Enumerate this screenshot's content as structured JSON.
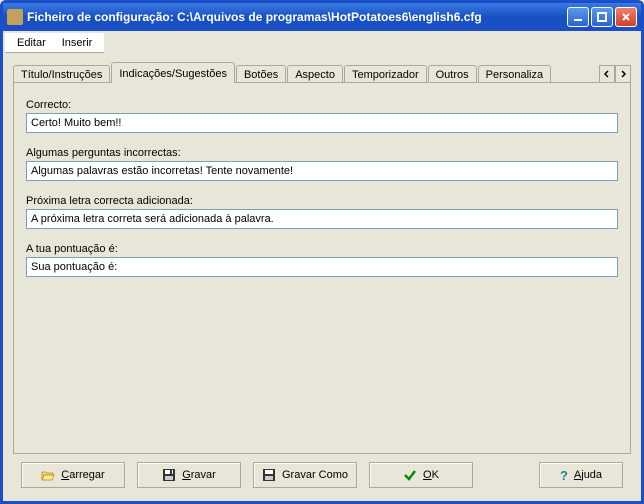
{
  "window": {
    "title": "Ficheiro de configuração: C:\\Arquivos de programas\\HotPotatoes6\\english6.cfg"
  },
  "menu": {
    "edit": "Editar",
    "insert": "Inserir"
  },
  "tabs": {
    "t0": "Título/Instruções",
    "t1": "Indicações/Sugestões",
    "t2": "Botões",
    "t3": "Aspecto",
    "t4": "Temporizador",
    "t5": "Outros",
    "t6": "Personaliza"
  },
  "fields": {
    "correct": {
      "label": "Correcto:",
      "value": "Certo! Muito bem!!"
    },
    "wrong": {
      "label": "Algumas perguntas incorrectas:",
      "value": "Algumas palavras estão incorretas! Tente novamente!"
    },
    "next": {
      "label": "Próxima letra correcta adicionada:",
      "value": "A próxima letra correta será adicionada à palavra."
    },
    "score": {
      "label": "A tua pontuação é:",
      "value": "Sua pontuação é:"
    }
  },
  "buttons": {
    "load": "Carregar",
    "save": "Gravar",
    "saveas": "Gravar Como",
    "ok": "OK",
    "help": "Ajuda"
  }
}
